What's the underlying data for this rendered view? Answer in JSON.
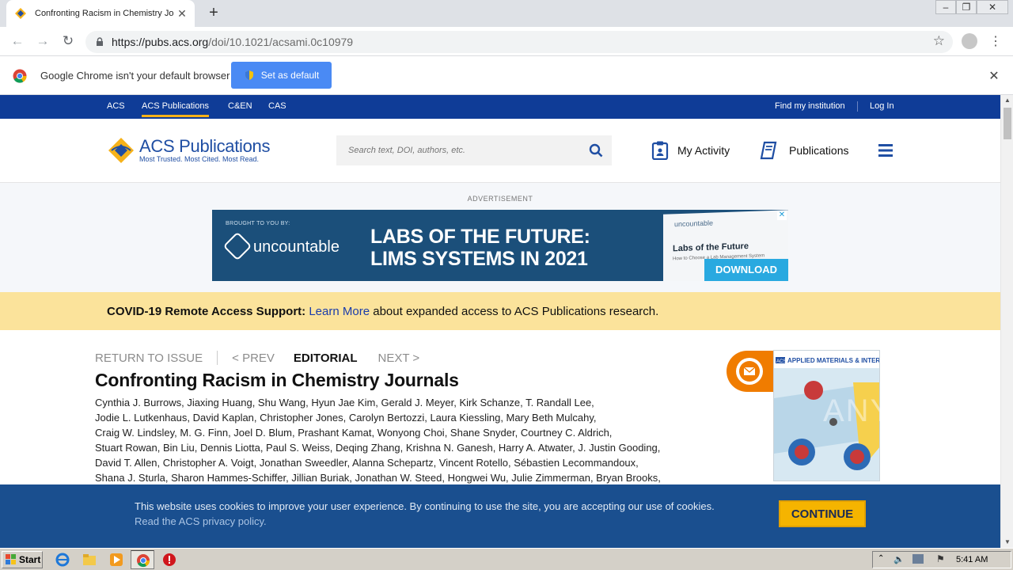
{
  "browser": {
    "tab_title": "Confronting Racism in Chemistry Journals",
    "tab_close": "✕",
    "new_tab": "+",
    "url_host": "https://pubs.acs.org",
    "url_path": "/doi/10.1021/acsami.0c10979",
    "window_min": "‒",
    "window_max": "❐",
    "window_close": "✕"
  },
  "infobar": {
    "text": "Google Chrome isn't your default browser",
    "button": "Set as default",
    "close": "✕"
  },
  "topnav": {
    "items": [
      "ACS",
      "ACS Publications",
      "C&EN",
      "CAS"
    ],
    "find_institution": "Find my institution",
    "login": "Log In"
  },
  "header": {
    "logo_title": "ACS Publications",
    "logo_tagline": "Most Trusted. Most Cited. Most Read.",
    "search_placeholder": "Search text, DOI, authors, etc.",
    "my_activity": "My Activity",
    "publications": "Publications"
  },
  "ad": {
    "label": "ADVERTISEMENT",
    "brought": "BROUGHT TO YOU BY:",
    "brand": "uncountable",
    "headline_1": "LABS OF THE FUTURE:",
    "headline_2": "LIMS SYSTEMS IN 2021",
    "book_brand": "uncountable",
    "book_title": "Labs of the Future",
    "book_sub": "How to Choose a Lab Management System",
    "download": "DOWNLOAD",
    "close": "✕"
  },
  "covid": {
    "bold": "COVID-19 Remote Access Support:",
    "link": "Learn More",
    "rest": "about expanded access to ACS Publications research."
  },
  "article": {
    "return": "RETURN TO ISSUE",
    "prev": "< PREV",
    "type": "EDITORIAL",
    "next": "NEXT >",
    "title": "Confronting Racism in Chemistry Journals",
    "authors": [
      "Cynthia J. Burrows, Jiaxing Huang, Shu Wang, Hyun Jae Kim, Gerald J. Meyer, Kirk Schanze, T. Randall Lee,",
      "Jodie L. Lutkenhaus, David Kaplan, Christopher Jones, Carolyn Bertozzi, Laura Kiessling, Mary Beth Mulcahy,",
      "Craig W. Lindsley, M. G. Finn, Joel D. Blum, Prashant Kamat, Wonyong Choi, Shane Snyder, Courtney C. Aldrich,",
      "Stuart Rowan, Bin Liu, Dennis Liotta, Paul S. Weiss, Deqing Zhang, Krishna N. Ganesh, Harry A. Atwater, J. Justin Gooding,",
      "David T. Allen, Christopher A. Voigt, Jonathan Sweedler, Alanna Schepartz, Vincent Rotello, Sébastien Lecommandoux,",
      "Shana J. Sturla, Sharon Hammes-Schiffer, Jillian Buriak, Jonathan W. Steed, Hongwei Wu, Julie Zimmerman, Bryan Brooks,"
    ],
    "cover_brand": "ACS",
    "cover_title": "APPLIED MATERIALS & INTERFACES"
  },
  "cookie": {
    "text": "This website uses cookies to improve your user experience. By continuing to use the site, you are accepting our use of cookies.",
    "link": "Read the ACS privacy policy.",
    "button": "CONTINUE"
  },
  "watermark": "ANY RUN",
  "taskbar": {
    "start": "Start",
    "clock": "5:41 AM"
  },
  "colors": {
    "acs_blue": "#0f3c97",
    "acs_gold": "#f6b21a",
    "covid_bg": "#fbe39b",
    "cookie_bg": "#1a4f8f",
    "email_orange": "#f07c00"
  }
}
